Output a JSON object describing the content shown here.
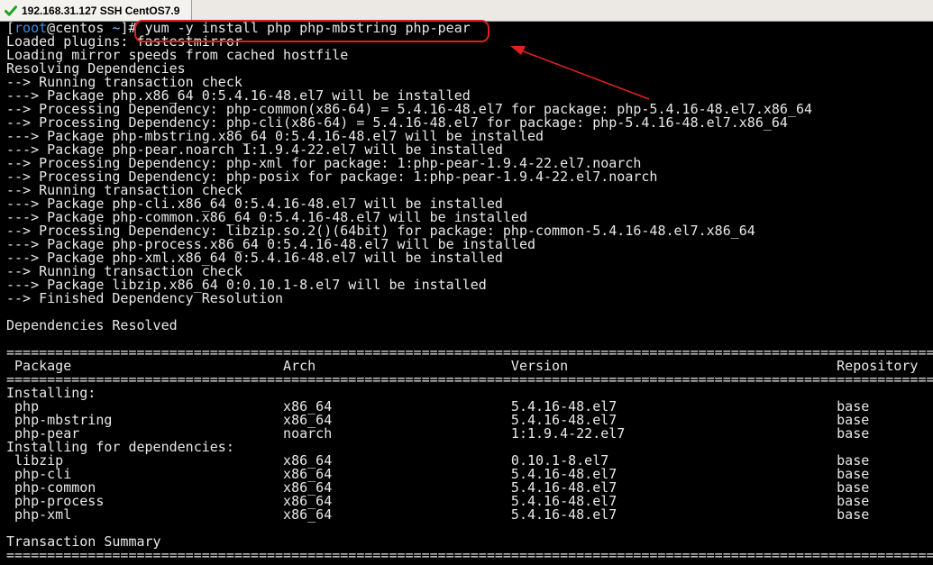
{
  "tab": {
    "title": "192.168.31.127 SSH CentOS7.9",
    "status_color": "#1aa51a",
    "icon": "check-icon"
  },
  "prompt": {
    "open": "[",
    "user": "root",
    "at": "@",
    "host": "centos",
    "cwd": "~",
    "close": "]#",
    "command": " yum -y install php php-mbstring php-pear"
  },
  "annotation": {
    "color": "#e02020"
  },
  "lines": [
    "Loaded plugins: fastestmirror",
    "Loading mirror speeds from cached hostfile",
    "Resolving Dependencies",
    "--> Running transaction check",
    "---> Package php.x86_64 0:5.4.16-48.el7 will be installed",
    "--> Processing Dependency: php-common(x86-64) = 5.4.16-48.el7 for package: php-5.4.16-48.el7.x86_64",
    "--> Processing Dependency: php-cli(x86-64) = 5.4.16-48.el7 for package: php-5.4.16-48.el7.x86_64",
    "---> Package php-mbstring.x86_64 0:5.4.16-48.el7 will be installed",
    "---> Package php-pear.noarch 1:1.9.4-22.el7 will be installed",
    "--> Processing Dependency: php-xml for package: 1:php-pear-1.9.4-22.el7.noarch",
    "--> Processing Dependency: php-posix for package: 1:php-pear-1.9.4-22.el7.noarch",
    "--> Running transaction check",
    "---> Package php-cli.x86_64 0:5.4.16-48.el7 will be installed",
    "---> Package php-common.x86_64 0:5.4.16-48.el7 will be installed",
    "--> Processing Dependency: libzip.so.2()(64bit) for package: php-common-5.4.16-48.el7.x86_64",
    "---> Package php-process.x86_64 0:5.4.16-48.el7 will be installed",
    "---> Package php-xml.x86_64 0:5.4.16-48.el7 will be installed",
    "--> Running transaction check",
    "---> Package libzip.x86_64 0:0.10.1-8.el7 will be installed",
    "--> Finished Dependency Resolution",
    "",
    "Dependencies Resolved",
    "",
    "=======================================================================================================================",
    " Package                          Arch                        Version                                 Repository",
    "=======================================================================================================================",
    "Installing:",
    " php                              x86_64                      5.4.16-48.el7                           base",
    " php-mbstring                     x86_64                      5.4.16-48.el7                           base",
    " php-pear                         noarch                      1:1.9.4-22.el7                          base",
    "Installing for dependencies:",
    " libzip                           x86_64                      0.10.1-8.el7                            base",
    " php-cli                          x86_64                      5.4.16-48.el7                           base",
    " php-common                       x86_64                      5.4.16-48.el7                           base",
    " php-process                      x86_64                      5.4.16-48.el7                           base",
    " php-xml                          x86_64                      5.4.16-48.el7                           base",
    "",
    "Transaction Summary",
    "======================================================================================================================="
  ]
}
